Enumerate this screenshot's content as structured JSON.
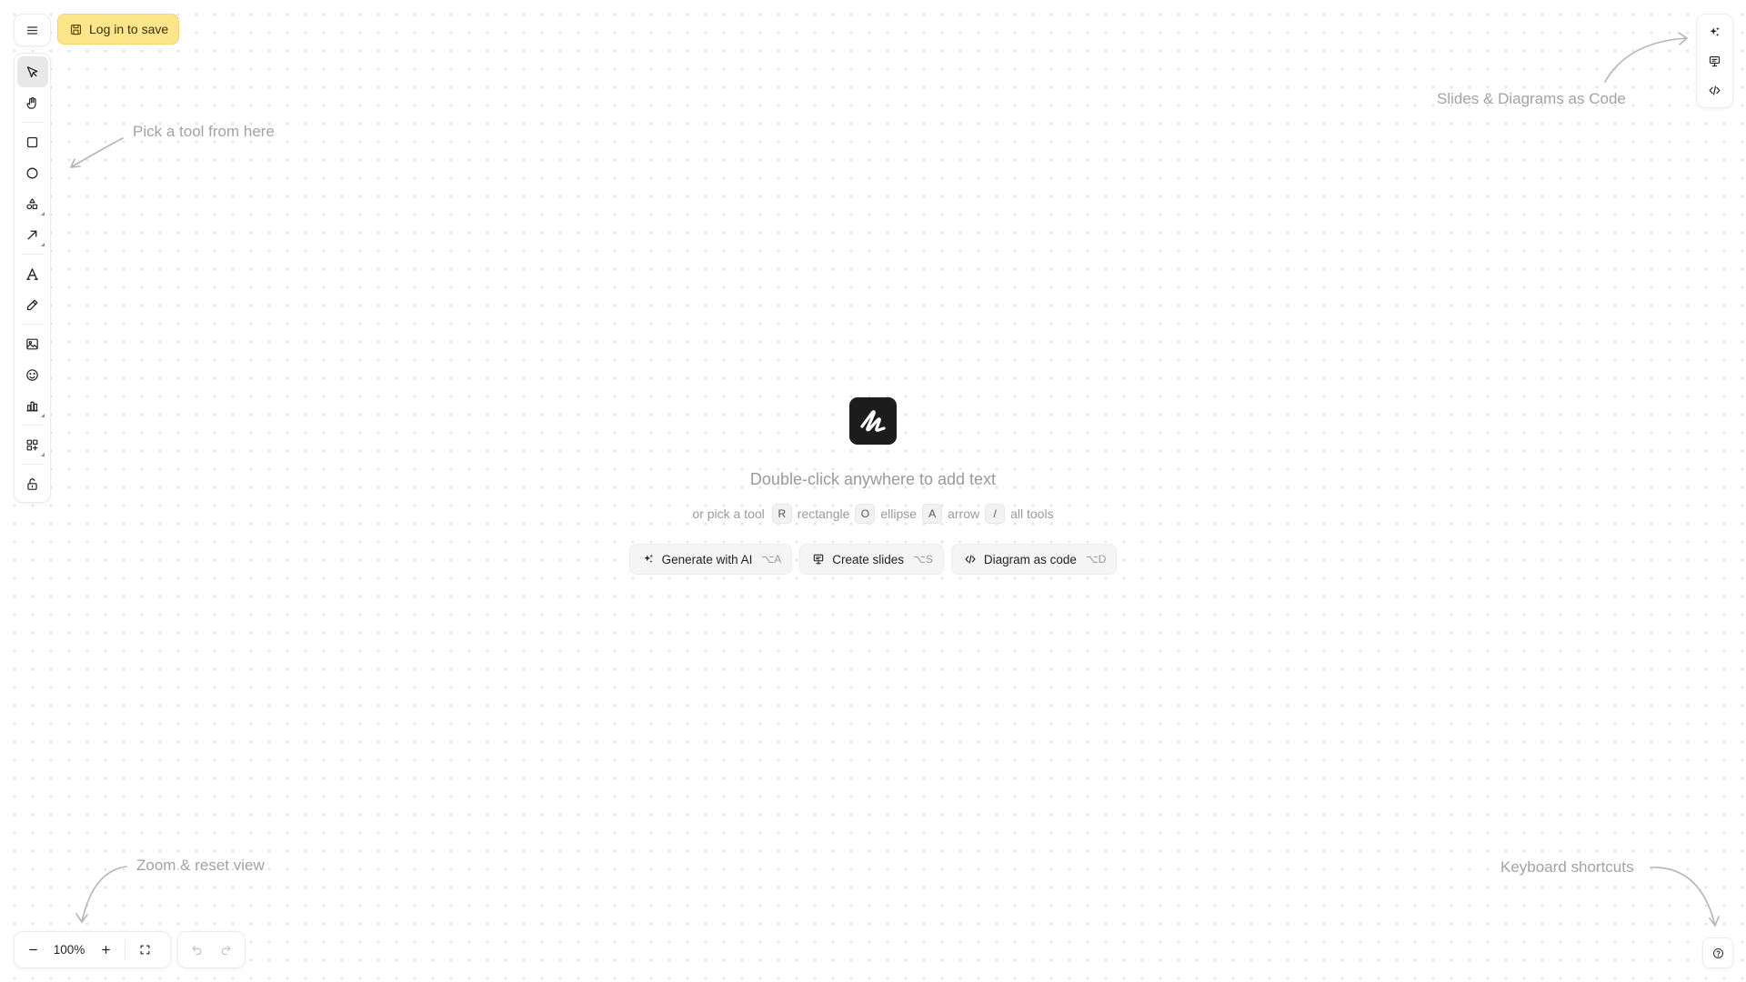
{
  "header": {
    "login_label": "Log in to save"
  },
  "toolbar": {
    "tools": [
      {
        "name": "select",
        "icon": "cursor-arrow-icon",
        "active": true
      },
      {
        "name": "hand",
        "icon": "hand-icon"
      },
      {
        "name": "rectangle",
        "icon": "square-icon"
      },
      {
        "name": "ellipse",
        "icon": "circle-icon"
      },
      {
        "name": "shapes",
        "icon": "shapes-icon"
      },
      {
        "name": "arrow",
        "icon": "arrow-up-right-icon"
      },
      {
        "name": "text",
        "icon": "text-a-icon"
      },
      {
        "name": "draw",
        "icon": "pencil-icon"
      },
      {
        "name": "image",
        "icon": "image-icon"
      },
      {
        "name": "emoji",
        "icon": "smiley-icon"
      },
      {
        "name": "chart",
        "icon": "bar-chart-icon"
      },
      {
        "name": "library",
        "icon": "grid-plus-icon"
      },
      {
        "name": "lock",
        "icon": "lock-open-icon"
      }
    ]
  },
  "hints": {
    "tools": "Pick a tool from here",
    "code": "Slides & Diagrams as Code",
    "zoom": "Zoom & reset view",
    "shortcuts": "Keyboard shortcuts"
  },
  "center": {
    "title": "Double-click anywhere to add text",
    "prefix": "or pick a tool",
    "shortcuts": [
      {
        "key": "R",
        "label": "rectangle"
      },
      {
        "key": "O",
        "label": "ellipse"
      },
      {
        "key": "A",
        "label": "arrow"
      },
      {
        "key": "/",
        "label": "all tools"
      }
    ],
    "actions": [
      {
        "label": "Generate with AI",
        "shortcut": "⌥A",
        "icon": "sparkles-icon"
      },
      {
        "label": "Create slides",
        "shortcut": "⌥S",
        "icon": "presentation-icon"
      },
      {
        "label": "Diagram as code",
        "shortcut": "⌥D",
        "icon": "code-icon"
      }
    ]
  },
  "zoom": {
    "level": "100%"
  },
  "colors": {
    "accent_login": "#fde68a",
    "logo_bg": "#1c1c1c",
    "hint_text": "#a3a3a3"
  }
}
